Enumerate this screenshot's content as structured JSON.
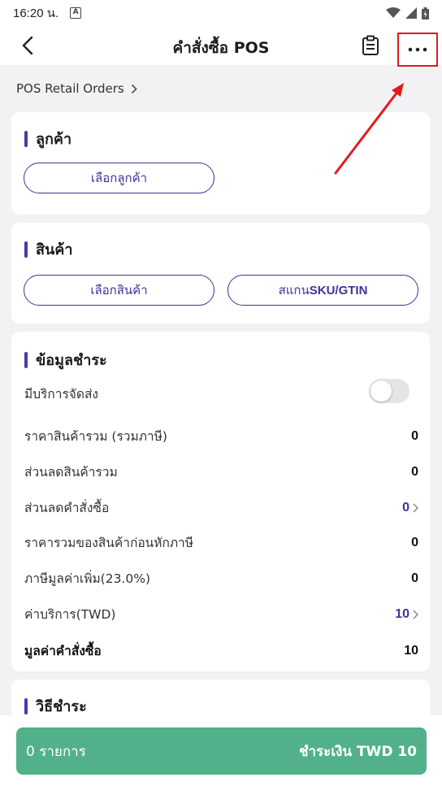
{
  "status_bar": {
    "time": "16:20 น.",
    "a_icon": "A"
  },
  "header": {
    "title": "คำสั่งซื้อ POS"
  },
  "breadcrumb": {
    "label": "POS Retail Orders"
  },
  "customer": {
    "title": "ลูกค้า",
    "select_button": "เลือกลูกค้า"
  },
  "products": {
    "title": "สินค้า",
    "select_button": "เลือกสินค้า",
    "scan_prefix": "สแกน ",
    "scan_code": "SKU/GTIN"
  },
  "payment_info": {
    "title": "ข้อมูลชำระ",
    "delivery_label": "มีบริการจัดส่ง",
    "delivery_enabled": false,
    "rows": [
      {
        "label": "ราคาสินค้ารวม (รวมภาษี)",
        "value": "0"
      },
      {
        "label": "ส่วนลดสินค้ารวม",
        "value": "0"
      },
      {
        "label": "ส่วนลดคำสั่งซื้อ",
        "value": "0"
      },
      {
        "label": "ราคารวมของสินค้าก่อนหักภาษี",
        "value": "0"
      },
      {
        "label": "ภาษีมูลค่าเพิ่ม(23.0%)",
        "value": "0"
      },
      {
        "label": "ค่าบริการ(TWD)",
        "value": "10"
      },
      {
        "label": "มูลค่าคำสั่งซื้อ",
        "value": "10"
      }
    ]
  },
  "payment_method": {
    "title": "วิธีชำระ"
  },
  "footer": {
    "item_count": "0 รายการ",
    "pay_label": "ชำระเงิน TWD 10"
  },
  "colors": {
    "accent": "#3f3597",
    "pay_button": "#52b18a",
    "highlight": "#e21b1b"
  }
}
